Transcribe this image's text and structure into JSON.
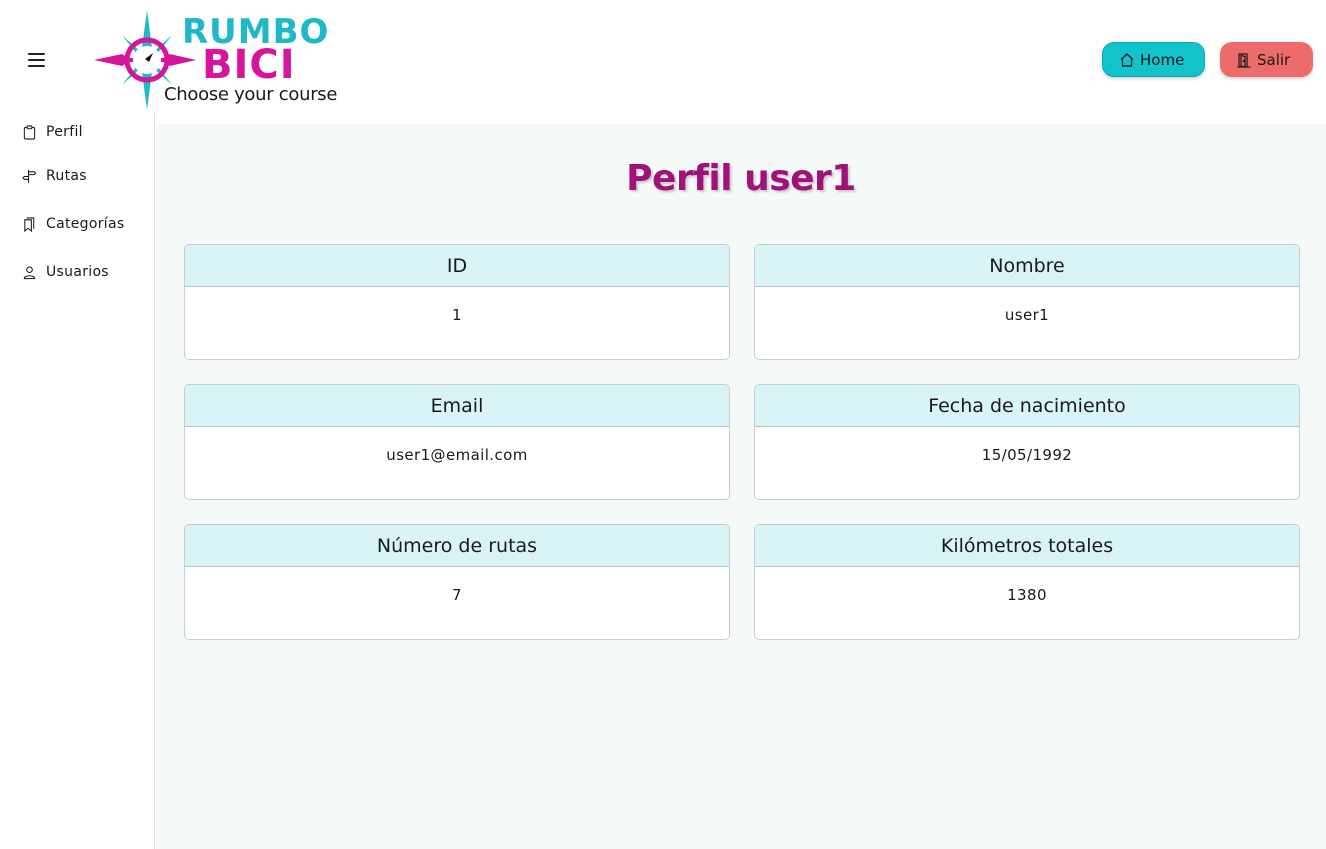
{
  "header": {
    "logo_top": "RUMBO",
    "logo_bottom": "BICI",
    "logo_tagline": "Choose your course",
    "home_label": "Home",
    "logout_label": "Salir"
  },
  "sidebar": {
    "items": [
      {
        "label": "Perfil",
        "icon": "clipboard-icon"
      },
      {
        "label": "Rutas",
        "icon": "signpost-icon"
      },
      {
        "label": "Categorías",
        "icon": "bookmarks-icon"
      },
      {
        "label": "Usuarios",
        "icon": "person-icon"
      }
    ]
  },
  "main": {
    "title": "Perfil user1",
    "cards": [
      {
        "label": "ID",
        "value": "1"
      },
      {
        "label": "Nombre",
        "value": "user1"
      },
      {
        "label": "Email",
        "value": "user1@email.com"
      },
      {
        "label": "Fecha de nacimiento",
        "value": "15/05/1992"
      },
      {
        "label": "Número de rutas",
        "value": "7"
      },
      {
        "label": "Kilómetros totales",
        "value": "1380"
      }
    ]
  },
  "colors": {
    "brand_cyan": "#1fb8c6",
    "brand_magenta": "#d6169a",
    "title": "#a0117a",
    "home_button": "#12c3cc",
    "logout_button": "#ee6b6b",
    "card_header": "#d9f4f6"
  }
}
